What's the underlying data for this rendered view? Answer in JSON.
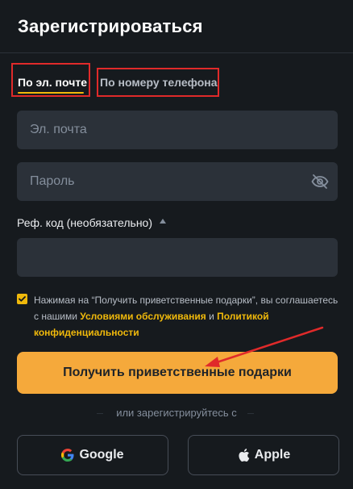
{
  "header": {
    "title": "Зарегистрироваться"
  },
  "tabs": [
    {
      "label": "По эл. почте",
      "active": true
    },
    {
      "label": "По номеру телефона",
      "active": false
    }
  ],
  "form": {
    "email_placeholder": "Эл. почта",
    "password_placeholder": "Пароль",
    "referral_label": "Реф. код (необязательно)",
    "referral_value": ""
  },
  "terms": {
    "checked": true,
    "text_before": "Нажимая на “Получить приветственные подарки”, вы соглашаетесь с нашими ",
    "link_terms": "Условиями обслуживания",
    "text_and": " и ",
    "link_privacy": "Политикой конфиденциальности"
  },
  "cta": {
    "label": "Получить приветственные подарки"
  },
  "divider": {
    "text": "или зарегистрируйтесь с"
  },
  "social": {
    "google_label": "Google",
    "apple_label": "Apple"
  },
  "colors": {
    "accent": "#f0b90b",
    "cta": "#f5a93b",
    "background": "#161a1e",
    "input": "#2b3139",
    "annotation": "#e02a2a"
  },
  "icons": [
    "eye-off-icon",
    "caret-up-icon",
    "check-icon",
    "google-icon",
    "apple-icon",
    "annotation-arrow"
  ]
}
